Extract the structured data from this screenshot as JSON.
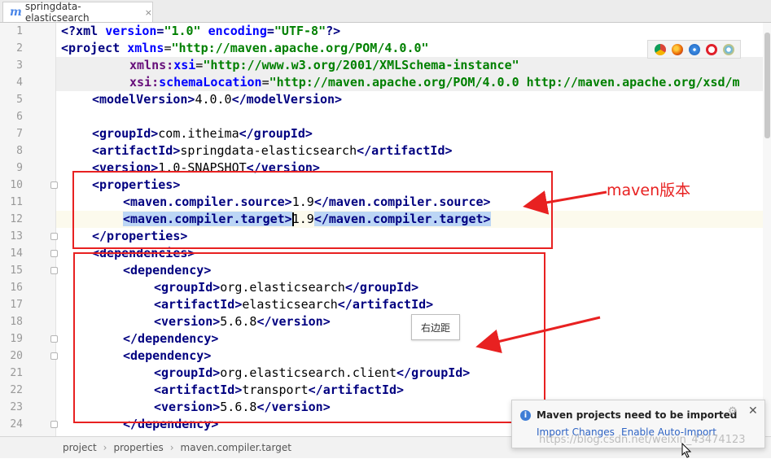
{
  "tab": {
    "icon": "m",
    "label": "springdata-elasticsearch",
    "close": "×"
  },
  "lines": [
    {
      "n": "1"
    },
    {
      "n": "2"
    },
    {
      "n": "3"
    },
    {
      "n": "4"
    },
    {
      "n": "5"
    },
    {
      "n": "6"
    },
    {
      "n": "7"
    },
    {
      "n": "8"
    },
    {
      "n": "9"
    },
    {
      "n": "10"
    },
    {
      "n": "11"
    },
    {
      "n": "12"
    },
    {
      "n": "13"
    },
    {
      "n": "14"
    },
    {
      "n": "15"
    },
    {
      "n": "16"
    },
    {
      "n": "17"
    },
    {
      "n": "18"
    },
    {
      "n": "19"
    },
    {
      "n": "20"
    },
    {
      "n": "21"
    },
    {
      "n": "22"
    },
    {
      "n": "23"
    },
    {
      "n": "24"
    }
  ],
  "code": {
    "l1": {
      "decl_open": "<?xml ",
      "a1": "version",
      "eq1": "=",
      "v1": "\"1.0\"",
      "sp": " ",
      "a2": "encoding",
      "eq2": "=",
      "v2": "\"UTF-8\"",
      "decl_close": "?>"
    },
    "l2": {
      "open": "<project ",
      "attr": "xmlns",
      "eq": "=",
      "val": "\"http://maven.apache.org/POM/4.0.0\""
    },
    "l3": {
      "pre": "xmlns:",
      "attr": "xsi",
      "eq": "=",
      "val": "\"http://www.w3.org/2001/XMLSchema-instance\""
    },
    "l4": {
      "pre": "xsi:",
      "attr": "schemaLocation",
      "eq": "=",
      "val": "\"http://maven.apache.org/POM/4.0.0 http://maven.apache.org/xsd/m"
    },
    "l5": {
      "open": "<modelVersion>",
      "text": "4.0.0",
      "close": "</modelVersion>"
    },
    "l7": {
      "open": "<groupId>",
      "text": "com.itheima",
      "close": "</groupId>"
    },
    "l8": {
      "open": "<artifactId>",
      "text": "springdata-elasticsearch",
      "close": "</artifactId>"
    },
    "l9": {
      "open": "<version>",
      "text": "1.0-SNAPSHOT",
      "close": "</version>"
    },
    "l10": {
      "open": "<properties>"
    },
    "l11": {
      "open": "<maven.compiler.source>",
      "text": "1.9",
      "close": "</maven.compiler.source>"
    },
    "l12": {
      "open": "<maven.compiler.target>",
      "text": "1.9",
      "close": "</maven.compiler.target>"
    },
    "l13": {
      "close": "</properties>"
    },
    "l14": {
      "open": "<dependencies>"
    },
    "l15": {
      "open": "<dependency>"
    },
    "l16": {
      "open": "<groupId>",
      "text": "org.elasticsearch",
      "close": "</groupId>"
    },
    "l17": {
      "open": "<artifactId>",
      "text": "elasticsearch",
      "close": "</artifactId>"
    },
    "l18": {
      "open": "<version>",
      "text": "5.6.8",
      "close": "</version>"
    },
    "l19": {
      "close": "</dependency>"
    },
    "l20": {
      "open": "<dependency>"
    },
    "l21": {
      "open": "<groupId>",
      "text": "org.elasticsearch.client",
      "close": "</groupId>"
    },
    "l22": {
      "open": "<artifactId>",
      "text": "transport",
      "close": "</artifactId>"
    },
    "l23": {
      "open": "<version>",
      "text": "5.6.8",
      "close": "</version>"
    },
    "l24": {
      "close": "</dependency>"
    }
  },
  "annotation": {
    "label": "maven版本",
    "color": "#e82121"
  },
  "tooltip": {
    "text": "右边距"
  },
  "breadcrumb": {
    "items": [
      "project",
      "properties",
      "maven.compiler.target"
    ],
    "sep": "›"
  },
  "notification": {
    "title": "Maven projects need to be imported",
    "import_changes": "Import Changes",
    "enable_auto_import": "Enable Auto-Import",
    "info": "i",
    "gear": "⚙",
    "close": "✕"
  },
  "browser_icons": [
    "chrome-icon",
    "firefox-icon",
    "safari-icon",
    "opera-icon",
    "ie-icon"
  ],
  "watermark": "https://blog.csdn.net/weixin_43474123",
  "colors": {
    "tag": "#000080",
    "attr_value": "#008000",
    "attr_name": "#0000ff",
    "highlight": "#e82121"
  }
}
